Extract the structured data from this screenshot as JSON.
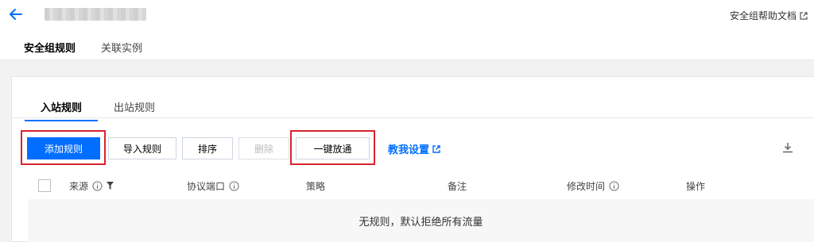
{
  "header": {
    "help_doc": "安全组帮助文档"
  },
  "page_tabs": [
    {
      "label": "安全组规则",
      "active": true
    },
    {
      "label": "关联实例",
      "active": false
    }
  ],
  "inner_tabs": [
    {
      "label": "入站规则",
      "active": true
    },
    {
      "label": "出站规则",
      "active": false
    }
  ],
  "toolbar": {
    "add_rule": "添加规则",
    "import_rule": "导入规则",
    "sort": "排序",
    "delete": "删除",
    "one_click_open": "一键放通",
    "teach_me": "教我设置"
  },
  "table": {
    "columns": [
      "来源",
      "协议端口",
      "策略",
      "备注",
      "修改时间",
      "操作"
    ],
    "empty_text": "无规则，默认拒绝所有流量"
  },
  "colors": {
    "primary": "#006eff",
    "highlight": "#d9232e"
  },
  "icons": [
    "back-arrow-icon",
    "external-link-icon",
    "download-icon",
    "info-icon",
    "filter-icon"
  ]
}
